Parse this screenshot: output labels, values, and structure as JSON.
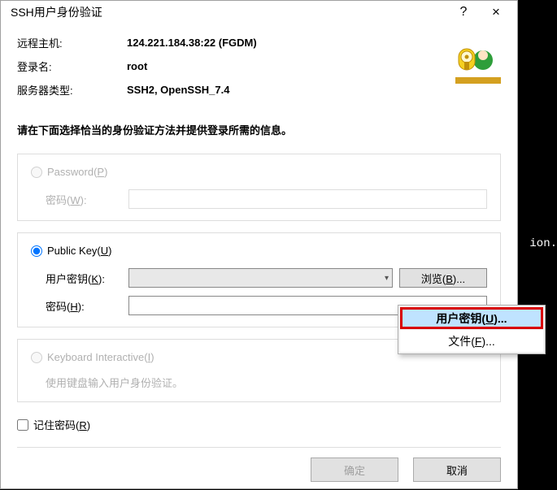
{
  "backdrop": {
    "fragment": "ion."
  },
  "dialog": {
    "title": "SSH用户身份验证",
    "help": "?",
    "close": "×",
    "info": {
      "remote_host_label": "远程主机:",
      "remote_host_value": "124.221.184.38:22 (FGDM)",
      "login_label": "登录名:",
      "login_value": "root",
      "server_type_label": "服务器类型:",
      "server_type_value": "SSH2, OpenSSH_7.4"
    },
    "instruction": "请在下面选择恰当的身份验证方法并提供登录所需的信息。",
    "password_section": {
      "title_prefix": "Password(",
      "title_key": "P",
      "title_suffix": ")",
      "pwd_label_prefix": "密码(",
      "pwd_label_key": "W",
      "pwd_label_suffix": "):"
    },
    "publickey_section": {
      "title_prefix": "Public Key(",
      "title_key": "U",
      "title_suffix": ")",
      "userkey_prefix": "用户密钥(",
      "userkey_key": "K",
      "userkey_suffix": "):",
      "pwd_prefix": "密码(",
      "pwd_key": "H",
      "pwd_suffix": "):",
      "browse_prefix": "浏览(",
      "browse_key": "B",
      "browse_suffix": ")..."
    },
    "keyboard_section": {
      "title_prefix": "Keyboard Interactive(",
      "title_key": "I",
      "title_suffix": ")",
      "hint": "使用键盘输入用户身份验证。"
    },
    "remember_prefix": "记住密码(",
    "remember_key": "R",
    "remember_suffix": ")",
    "footer": {
      "ok": "确定",
      "cancel": "取消"
    }
  },
  "dropdown": {
    "item1_prefix": "用户密钥(",
    "item1_key": "U",
    "item1_suffix": ")...",
    "item2_prefix": "文件(",
    "item2_key": "F",
    "item2_suffix": ")..."
  }
}
